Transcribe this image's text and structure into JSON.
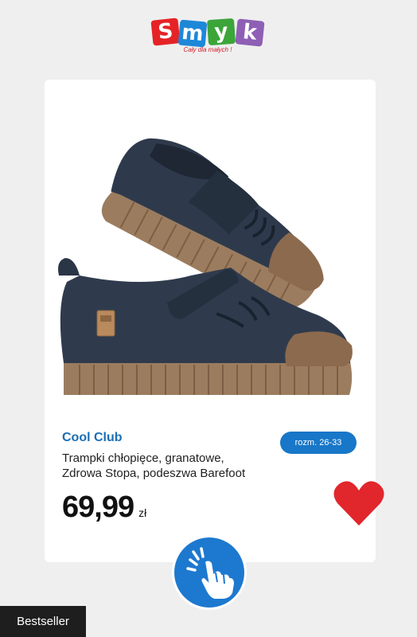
{
  "logo": {
    "letters": [
      "S",
      "m",
      "y",
      "k"
    ],
    "letter_colors": [
      "#e52326",
      "#1e88d8",
      "#3ba53a",
      "#8e5fb5"
    ],
    "tagline": "Cały dla małych !"
  },
  "product": {
    "brand": "Cool Club",
    "title_line1": "Trampki chłopięce, granatowe,",
    "title_line2": "Zdrowa Stopa, podeszwa Barefoot",
    "size_badge": "rozm. 26-33",
    "price_value": "69,99",
    "price_currency": "zł",
    "image_icon": "sneakers-image"
  },
  "actions": {
    "favorite_icon": "heart-icon",
    "tap_icon": "tap-hand-icon"
  },
  "badge": {
    "label": "Bestseller"
  },
  "colors": {
    "brand_blue": "#1b6fb4",
    "badge_blue": "#1877c8",
    "heart_red": "#e1262c",
    "tap_button_blue": "#1d79cf",
    "bestseller_bg": "#1e1e1e",
    "bestseller_text": "#ffffff"
  }
}
